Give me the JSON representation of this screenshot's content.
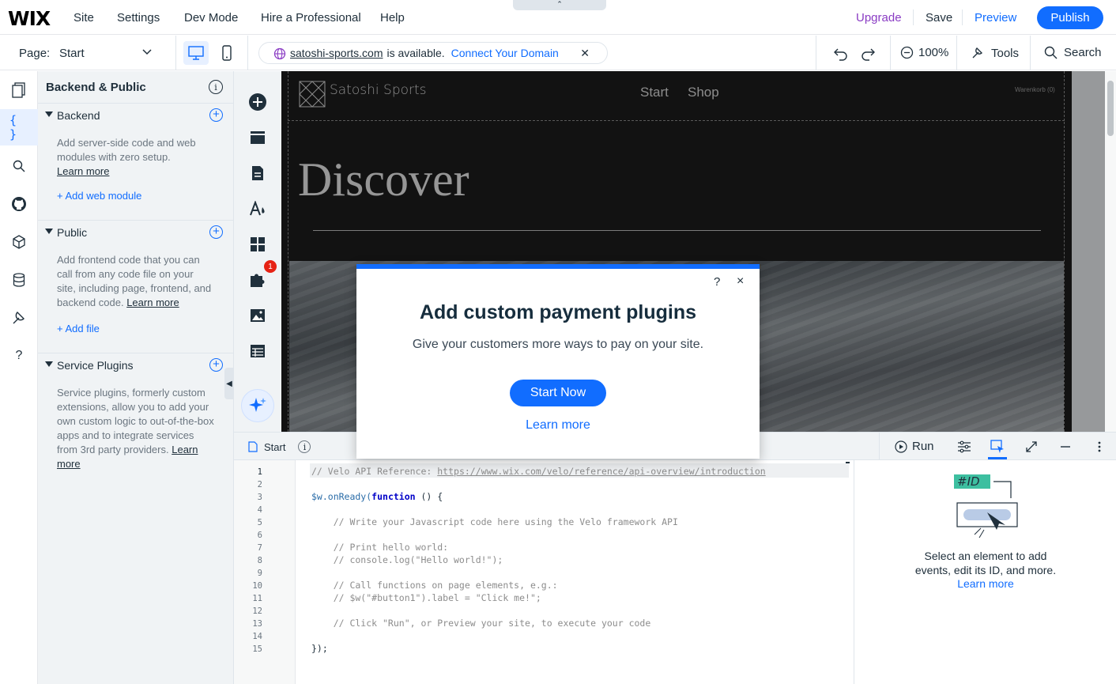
{
  "topbar": {
    "logo": "WIX",
    "menu": [
      "Site",
      "Settings",
      "Dev Mode",
      "Hire a Professional",
      "Help"
    ],
    "upgrade": "Upgrade",
    "save": "Save",
    "preview": "Preview",
    "publish": "Publish"
  },
  "secondbar": {
    "page_label": "Page:",
    "page_value": "Start",
    "domain_name": "satoshi-sports.com",
    "domain_available": "is available.",
    "connect_domain": "Connect Your Domain",
    "zoom": "100%",
    "tools": "Tools",
    "search": "Search"
  },
  "sidepanel": {
    "title": "Backend & Public",
    "sections": [
      {
        "label": "Backend",
        "text": "Add server-side code and web modules with zero setup.",
        "learn_more": "Learn more",
        "action": "+ Add web module"
      },
      {
        "label": "Public",
        "text": "Add frontend code that you can call from any code file on your site, including page, frontend, and backend code.",
        "learn_more": "Learn more",
        "action": "+ Add file"
      },
      {
        "label": "Service Plugins",
        "text": "Service plugins, formerly custom extensions, allow you to add your own custom logic to out-of-the-box apps and to integrate services from 3rd party providers.",
        "learn_more": "Learn more"
      }
    ]
  },
  "addrail": {
    "badge": "1"
  },
  "site": {
    "name": "Satoshi Sports",
    "nav": [
      "Start",
      "Shop"
    ],
    "cart": "Warenkorb (0)",
    "heading": "Discover"
  },
  "modal": {
    "title": "Add custom payment plugins",
    "subtitle": "Give your customers more ways to pay on your site.",
    "start": "Start Now",
    "learn": "Learn more",
    "help": "?",
    "close": "×"
  },
  "codepanel": {
    "file_tab": "Start",
    "run": "Run",
    "line_numbers": [
      "1",
      "2",
      "3",
      "4",
      "5",
      "6",
      "7",
      "8",
      "9",
      "10",
      "11",
      "12",
      "13",
      "14",
      "15"
    ],
    "code": {
      "l1_prefix": "// Velo API Reference: ",
      "l1_link": "https://www.wix.com/velo/reference/api-overview/introduction",
      "l3_a": "$w.onReady(",
      "l3_kw": "function",
      "l3_b": " () {",
      "l5": "    // Write your Javascript code here using the Velo framework API",
      "l7": "    // Print hello world:",
      "l8": "    // console.log(\"Hello world!\");",
      "l10": "    // Call functions on page elements, e.g.:",
      "l11": "    // $w(\"#button1\").label = \"Click me!\";",
      "l13": "    // Click \"Run\", or Preview your site, to execute your code",
      "l15": "});"
    },
    "props": {
      "id_tag": "#ID",
      "text": "Select an element to add events, edit its ID, and more.",
      "learn": "Learn more"
    }
  }
}
